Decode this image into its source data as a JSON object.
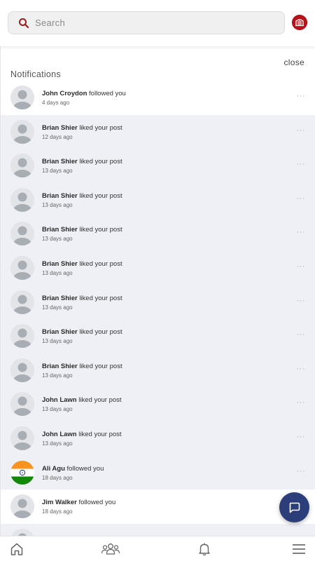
{
  "search": {
    "placeholder": "Search"
  },
  "panel": {
    "title": "Notifications",
    "close_label": "close"
  },
  "notifications": [
    {
      "name": "John Croydon",
      "action": "followed you",
      "time": "4 days ago",
      "unread": false,
      "avatar": "default-avatar"
    },
    {
      "name": "Brian Shier",
      "action": "liked your post",
      "time": "12 days ago",
      "unread": true,
      "avatar": "default-avatar"
    },
    {
      "name": "Brian Shier",
      "action": "liked your post",
      "time": "13 days ago",
      "unread": true,
      "avatar": "default-avatar"
    },
    {
      "name": "Brian Shier",
      "action": "liked your post",
      "time": "13 days ago",
      "unread": true,
      "avatar": "default-avatar"
    },
    {
      "name": "Brian Shier",
      "action": "liked your post",
      "time": "13 days ago",
      "unread": true,
      "avatar": "default-avatar"
    },
    {
      "name": "Brian Shier",
      "action": "liked your post",
      "time": "13 days ago",
      "unread": true,
      "avatar": "default-avatar"
    },
    {
      "name": "Brian Shier",
      "action": "liked your post",
      "time": "13 days ago",
      "unread": true,
      "avatar": "default-avatar"
    },
    {
      "name": "Brian Shier",
      "action": "liked your post",
      "time": "13 days ago",
      "unread": true,
      "avatar": "default-avatar"
    },
    {
      "name": "Brian Shier",
      "action": "liked your post",
      "time": "13 days ago",
      "unread": true,
      "avatar": "default-avatar"
    },
    {
      "name": "John Lawn",
      "action": "liked your post",
      "time": "13 days ago",
      "unread": true,
      "avatar": "default-avatar"
    },
    {
      "name": "John Lawn",
      "action": "liked your post",
      "time": "13 days ago",
      "unread": true,
      "avatar": "default-avatar"
    },
    {
      "name": "Ali Agu",
      "action": "followed you",
      "time": "18 days ago",
      "unread": true,
      "avatar": "india-flag"
    },
    {
      "name": "Jim Walker",
      "action": "followed you",
      "time": "18 days ago",
      "unread": false,
      "avatar": "default-avatar"
    },
    {
      "name": "",
      "action": "",
      "time": "",
      "unread": true,
      "avatar": "default-avatar"
    }
  ],
  "more_label": "···",
  "icons": {
    "search": "search-icon",
    "logo": "brand-logo",
    "fab": "chat-icon",
    "nav": [
      "home-icon",
      "community-icon",
      "bell-icon",
      "menu-icon"
    ]
  },
  "colors": {
    "brand": "#b5121b",
    "fab": "#2c3e7a",
    "unread_row": "#eef0f5",
    "avatar_gray": "#a9aeb5"
  }
}
